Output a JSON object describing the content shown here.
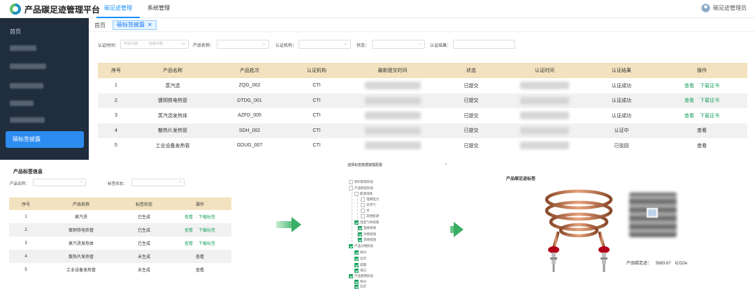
{
  "app": {
    "title": "产品碳足迹管理平台",
    "nav": [
      "碳足迹管理",
      "系统管理"
    ],
    "user": "碳足迹管理员"
  },
  "sidebar": {
    "home": "首页",
    "active": "碳标签披露"
  },
  "tabs": {
    "home": "首页",
    "current": "碳标签披露"
  },
  "filters": {
    "cert_time_label": "认证时间：",
    "start_placeholder": "开始日期",
    "end_placeholder": "结束日期",
    "date_sep": "→",
    "product_label": "产品名称：",
    "org_label": "认证机构：",
    "status_label": "状态：",
    "result_label": "认证结果："
  },
  "main_table": {
    "headers": [
      "序号",
      "产品名称",
      "产品批次",
      "认证机构",
      "最新提交时间",
      "状态",
      "认证时间",
      "认证结果",
      "操作"
    ],
    "rows": [
      {
        "no": "1",
        "name": "蒸汽烫",
        "batch": "ZQG_002",
        "org": "CTI",
        "status": "已提交",
        "result": "认证成功",
        "result_type": "ok",
        "actions": [
          "查看",
          "下载证书"
        ]
      },
      {
        "no": "2",
        "name": "镀铜铁电热管",
        "batch": "DTDG_001",
        "org": "CTI",
        "status": "已提交",
        "result": "认证成功",
        "result_type": "ok",
        "actions": [
          "查看",
          "下载证书"
        ]
      },
      {
        "no": "3",
        "name": "蒸汽烫发热体",
        "batch": "AZFD_005",
        "org": "CTI",
        "status": "已提交",
        "result": "认证成功",
        "result_type": "ok",
        "actions": [
          "查看",
          "下载证书"
        ]
      },
      {
        "no": "4",
        "name": "散热片发热管",
        "batch": "SDH_002",
        "org": "CTI",
        "status": "已提交",
        "result": "认证中",
        "result_type": "mid",
        "actions": [
          "查看"
        ]
      },
      {
        "no": "5",
        "name": "工业设备发热管",
        "batch": "GDUG_007",
        "org": "CTI",
        "status": "已提交",
        "result": "已驳回",
        "result_type": "bad",
        "actions": [
          "查看"
        ]
      }
    ]
  },
  "label_panel": {
    "title": "产品标签信息",
    "product_label": "产品名称：",
    "status_label": "标签状态：",
    "headers": [
      "序号",
      "产品名称",
      "标签状态",
      "操作"
    ],
    "rows": [
      {
        "no": "1",
        "name": "蒸汽烫",
        "status": "已生成",
        "actions": [
          "查看",
          "下载标签"
        ]
      },
      {
        "no": "2",
        "name": "镀铜铁电热管",
        "status": "已生成",
        "actions": [
          "查看",
          "下载标签"
        ]
      },
      {
        "no": "3",
        "name": "蒸汽烫发热体",
        "status": "已生成",
        "actions": [
          "查看",
          "下载标签"
        ]
      },
      {
        "no": "4",
        "name": "散热片发热管",
        "status": "未生成",
        "actions": [
          "查看"
        ]
      },
      {
        "no": "5",
        "name": "工业设备发热管",
        "status": "未生成",
        "actions": [
          "查看"
        ]
      }
    ]
  },
  "tree_dialog": {
    "title": "选择标签数据披露配置",
    "close": "×",
    "nodes": [
      "原料获取阶段",
      "产品制造阶段",
      "能源消耗",
      "电网电力",
      "天然气",
      "水",
      "其他能源",
      "温室气体排放",
      "直接排放",
      "间接排放",
      "其他排放",
      "产品分销阶段",
      "杭州",
      "北京",
      "成都",
      "海口",
      "产品使用阶段",
      "杭州",
      "北京"
    ]
  },
  "carbon_label": {
    "title": "产品碳足迹标签",
    "footprint_label": "产品碳足迹：",
    "footprint_value": "5683.67",
    "unit": "tCO2e"
  },
  "colors": {
    "accent": "#1890ff",
    "sidebar": "#1f2d3d",
    "header_row": "#f3e2bf",
    "success": "#19a15f",
    "danger": "#e33333"
  }
}
